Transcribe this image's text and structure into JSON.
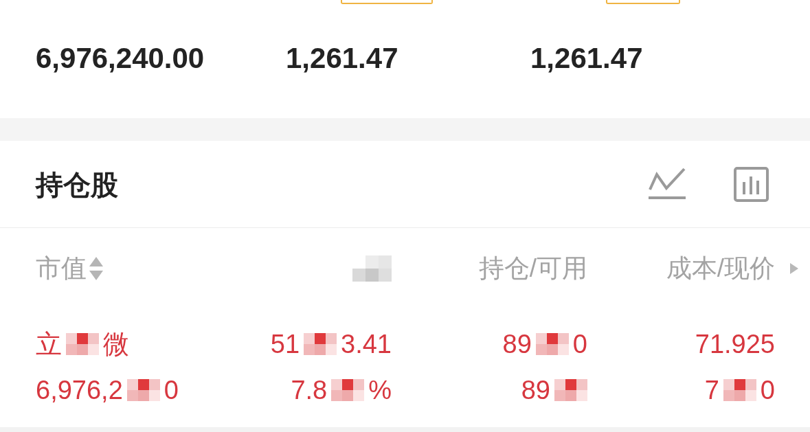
{
  "summary": [
    {
      "value": "6,976,240.00",
      "has_tag": false
    },
    {
      "value": "1,261.47",
      "has_tag": true
    },
    {
      "value": "1,261.47",
      "has_tag": true
    }
  ],
  "holdings": {
    "title": "持仓股",
    "columns": [
      {
        "label": "市值",
        "sortable": true
      },
      {
        "redacted": true
      },
      {
        "label": "持仓/可用"
      },
      {
        "label": "成本/现价",
        "more_arrow": true
      }
    ],
    "rows": [
      {
        "cells": [
          {
            "lines": [
              {
                "start": "立",
                "end": "微",
                "redacted": true
              },
              {
                "start": "6,976,2",
                "end": "0",
                "redacted": true
              }
            ]
          },
          {
            "lines": [
              {
                "start": "51",
                "end": "3.41",
                "redacted": true
              },
              {
                "start": "7.8",
                "end": "%",
                "redacted": true
              }
            ]
          },
          {
            "lines": [
              {
                "start": "89",
                "end": "0",
                "redacted": true
              },
              {
                "start": "89",
                "redacted": true
              }
            ]
          },
          {
            "lines": [
              {
                "start": "71.925"
              },
              {
                "start": "7",
                "end": "0",
                "redacted": true
              }
            ]
          }
        ]
      }
    ]
  }
}
